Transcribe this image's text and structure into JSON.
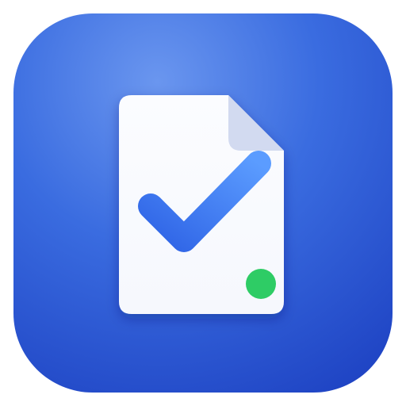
{
  "app_icon": {
    "glyph": "document-check-icon",
    "status_indicator": "green-dot",
    "colors": {
      "background_light": "#6a96ef",
      "background_mid": "#3a6ce0",
      "background_dark": "#1f44c4",
      "page_fill": "#f6f8fd",
      "page_fold": "#d2daf0",
      "check_light": "#5b9cff",
      "check_dark": "#2f64e6",
      "status_dot": "#2ecc65"
    }
  }
}
